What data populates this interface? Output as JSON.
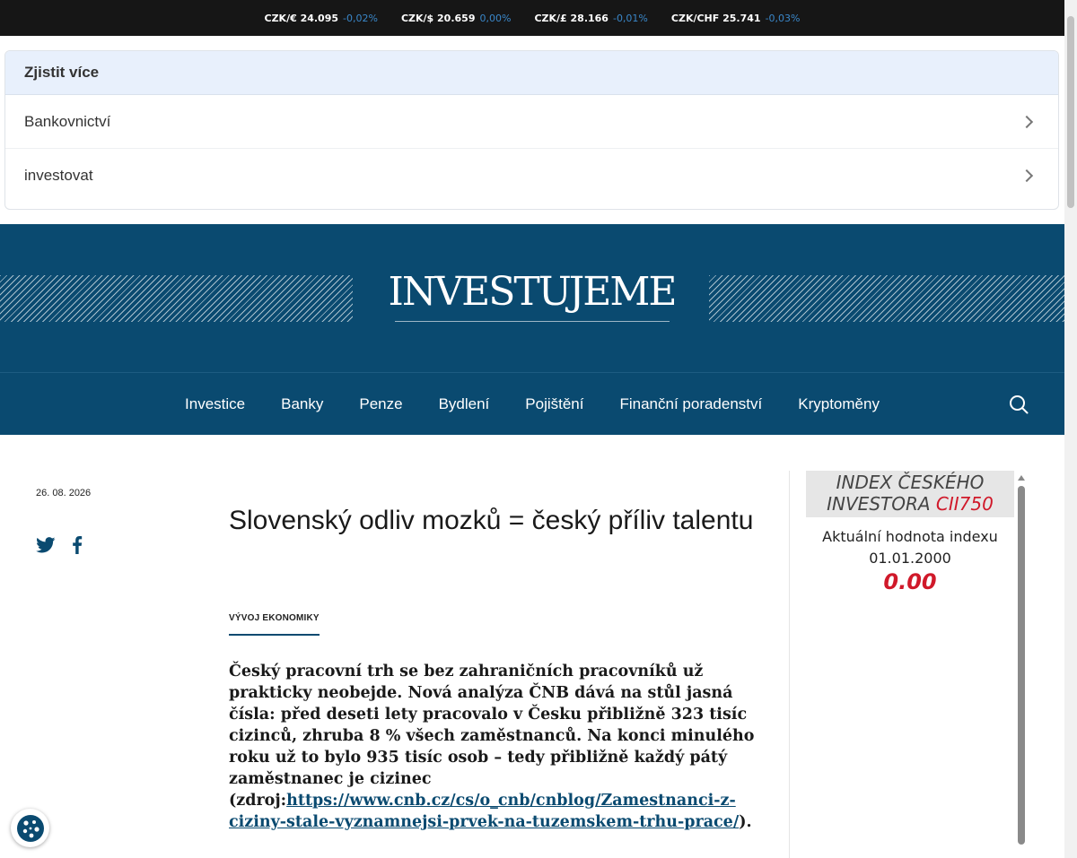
{
  "ticker": [
    {
      "pair": "CZK/€ 24.095",
      "change": "-0,02%"
    },
    {
      "pair": "CZK/$ 20.659",
      "change": "0,00%"
    },
    {
      "pair": "CZK/£ 28.166",
      "change": "-0,01%"
    },
    {
      "pair": "CZK/CHF 25.741",
      "change": "-0,03%"
    }
  ],
  "learn_more": {
    "title": "Zjistit více",
    "items": [
      {
        "label": "Bankovnictví"
      },
      {
        "label": "investovat"
      }
    ]
  },
  "brand": {
    "logo_text": "INVESTUJEME"
  },
  "nav": {
    "items": [
      "Investice",
      "Banky",
      "Penze",
      "Bydlení",
      "Pojištění",
      "Finanční poradenství",
      "Kryptoměny"
    ]
  },
  "article": {
    "date": "26. 08. 2026",
    "title": "Slovenský odliv mozků = český příliv talentu",
    "category": "VÝVOJ EKONOMIKY",
    "lead_text": "Český pracovní trh se bez zahraničních pracovníků už prakticky neobejde. Nová analýza ČNB dává na stůl jasná čísla: před deseti lety pracovalo v Česku přibližně 323 tisíc cizinců, zhruba 8 % všech zaměstnanců. Na konci minulého roku už to bylo 935 tisíc osob – tedy přibližně každý pátý zaměstnanec je cizinec (zdroj:",
    "lead_link": "https://www.cnb.cz/cs/o_cnb/cnblog/Zamestnanci-z-ciziny-stale-vyznamnejsi-prvek-na-tuzemskem-trhu-prace/",
    "lead_end": ")."
  },
  "widget": {
    "title": "INDEX ČESKÉHO INVESTORA",
    "code": "CII750",
    "label": "Aktuální hodnota indexu",
    "date": "01.01.2000",
    "value": "0.00"
  },
  "colors": {
    "brand": "#0a4a70",
    "accent_red": "#d0192a",
    "ticker_change": "#3a87c9"
  },
  "icons": [
    "twitter-icon",
    "facebook-icon",
    "search-icon",
    "chevron-right-icon",
    "cookie-icon"
  ]
}
